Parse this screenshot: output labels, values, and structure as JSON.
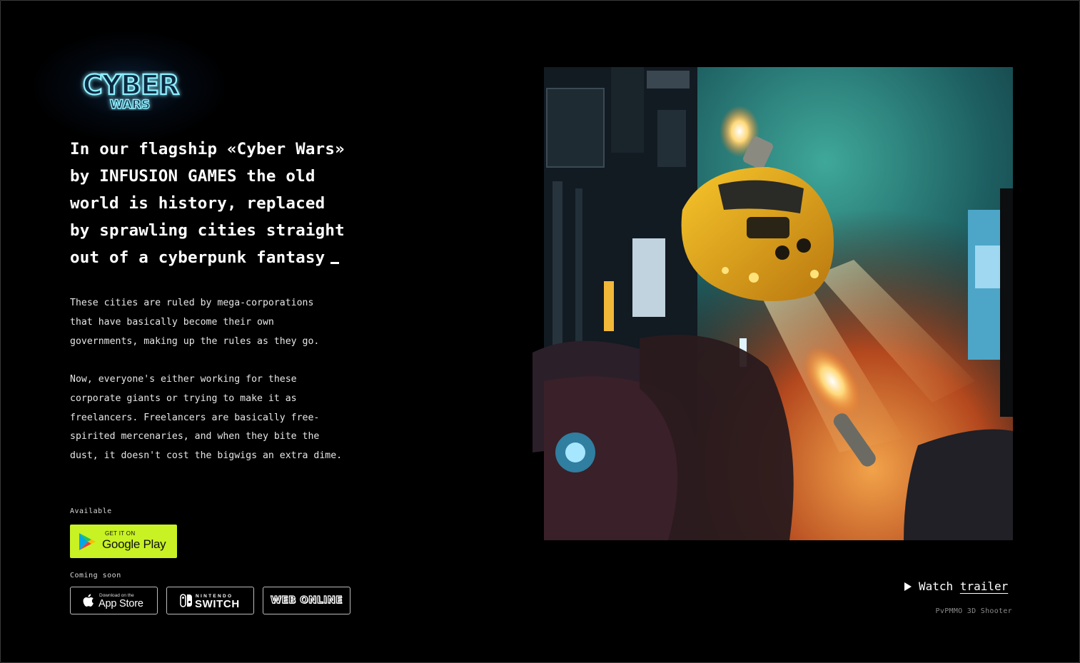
{
  "brand": {
    "logo_top": "CYBER",
    "logo_bottom": "WARS",
    "glow_color": "#6fe8ff"
  },
  "headline": {
    "lines": [
      "In our flagship «Cyber Wars»",
      "by INFUSION GAMES the old",
      "world is history, replaced",
      "by sprawling cities straight",
      "out of a cyberpunk fantasy"
    ]
  },
  "body": {
    "paragraph_1": "These cities are ruled by mega-corporations\nthat have basically become their own\ngovernments, making up the rules as they go.",
    "paragraph_2": "Now, everyone's either working for these\ncorporate giants or trying to make it as\nfreelancers. Freelancers are basically free-\nspirited mercenaries, and when they bite the\ndust, it doesn't cost the bigwigs an extra dime."
  },
  "availability": {
    "available_label": "Available",
    "google_play": {
      "small": "GET IT ON",
      "big": "Google Play",
      "icon": "google-play-icon",
      "bg_color": "#c8f223"
    },
    "coming_soon_label": "Coming soon",
    "app_store": {
      "small": "Download on the",
      "big": "App Store",
      "icon": "apple-icon"
    },
    "nintendo": {
      "small": "NINTENDO",
      "big": "SWITCH",
      "icon": "nintendo-switch-icon"
    },
    "web": {
      "label": "WEB ONLINE"
    }
  },
  "trailer": {
    "prefix": "Watch",
    "link": "trailer",
    "icon": "play-triangle-icon"
  },
  "genre": "PvPMMO 3D Shooter"
}
